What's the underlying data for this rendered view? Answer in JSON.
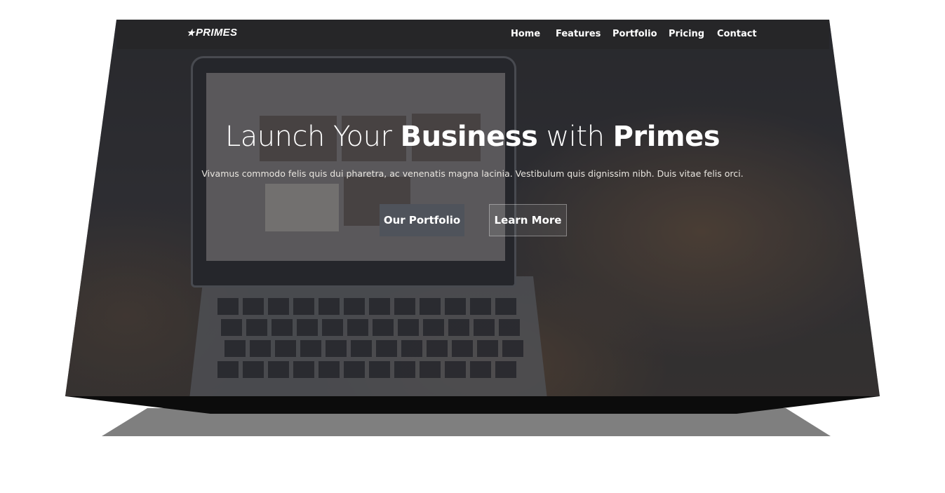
{
  "brand": {
    "logo_text": "PRIMES",
    "logo_icon": "star-icon"
  },
  "nav": {
    "items": [
      {
        "label": "Home"
      },
      {
        "label": "Features"
      },
      {
        "label": "Portfolio"
      },
      {
        "label": "Pricing"
      },
      {
        "label": "Contact"
      }
    ]
  },
  "hero": {
    "title_part1": "Launch Your ",
    "title_bold1": "Business",
    "title_part2": " with ",
    "title_bold2": "Primes",
    "subtitle": "Vivamus commodo felis quis dui pharetra, ac venenatis magna lacinia. Vestibulum quis dignissim nibh. Duis vitae felis orci.",
    "primary_button": "Our Portfolio",
    "secondary_button": "Learn More"
  },
  "colors": {
    "navbar_bg": "#262628",
    "primary_button_bg": "#4f535b",
    "text": "#ffffff"
  }
}
